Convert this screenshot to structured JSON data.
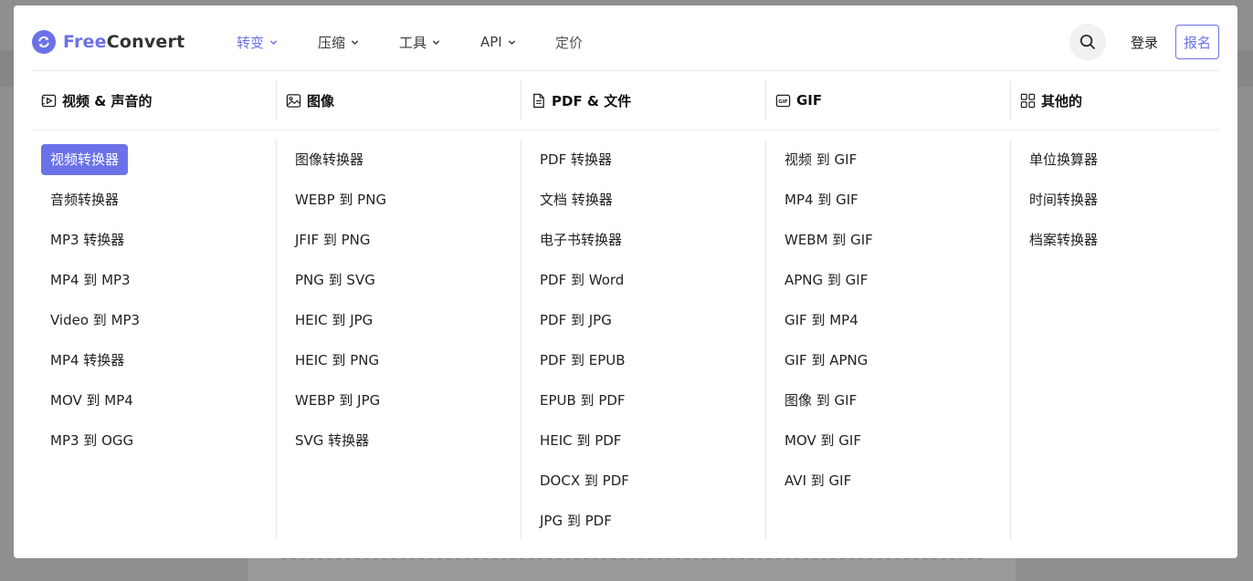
{
  "brand": {
    "name_accent": "Free",
    "name_rest": "Convert",
    "color": "#6b72e8"
  },
  "nav": {
    "items": [
      {
        "label": "转变",
        "has_dropdown": true,
        "active": true
      },
      {
        "label": "压缩",
        "has_dropdown": true,
        "active": false
      },
      {
        "label": "工具",
        "has_dropdown": true,
        "active": false
      },
      {
        "label": "API",
        "has_dropdown": true,
        "active": false
      },
      {
        "label": "定价",
        "has_dropdown": false,
        "active": false
      }
    ],
    "search_icon": "search-icon",
    "login": "登录",
    "signup": "报名"
  },
  "columns": [
    {
      "title": "视频 & 声音的",
      "icon": "video-icon",
      "links": [
        "视频转换器",
        "音频转换器",
        "MP3 转换器",
        "MP4 到 MP3",
        "Video 到 MP3",
        "MP4 转换器",
        "MOV 到 MP4",
        "MP3 到 OGG"
      ],
      "active_index": 0
    },
    {
      "title": "图像",
      "icon": "image-icon",
      "links": [
        "图像转换器",
        "WEBP 到 PNG",
        "JFIF 到 PNG",
        "PNG 到 SVG",
        "HEIC 到 JPG",
        "HEIC 到 PNG",
        "WEBP 到 JPG",
        "SVG 转换器"
      ]
    },
    {
      "title": "PDF & 文件",
      "icon": "document-icon",
      "links": [
        "PDF 转换器",
        "文档 转换器",
        "电子书转换器",
        "PDF 到 Word",
        "PDF 到 JPG",
        "PDF 到 EPUB",
        "EPUB 到 PDF",
        "HEIC 到 PDF",
        "DOCX 到 PDF",
        "JPG 到 PDF"
      ]
    },
    {
      "title": "GIF",
      "icon": "gif-icon",
      "links": [
        "视频 到 GIF",
        "MP4 到 GIF",
        "WEBM 到 GIF",
        "APNG 到 GIF",
        "GIF 到 MP4",
        "GIF 到 APNG",
        "图像 到 GIF",
        "MOV 到 GIF",
        "AVI 到 GIF"
      ]
    },
    {
      "title": "其他的",
      "icon": "grid-icon",
      "links": [
        "单位换算器",
        "时间转换器",
        "档案转换器"
      ]
    }
  ]
}
